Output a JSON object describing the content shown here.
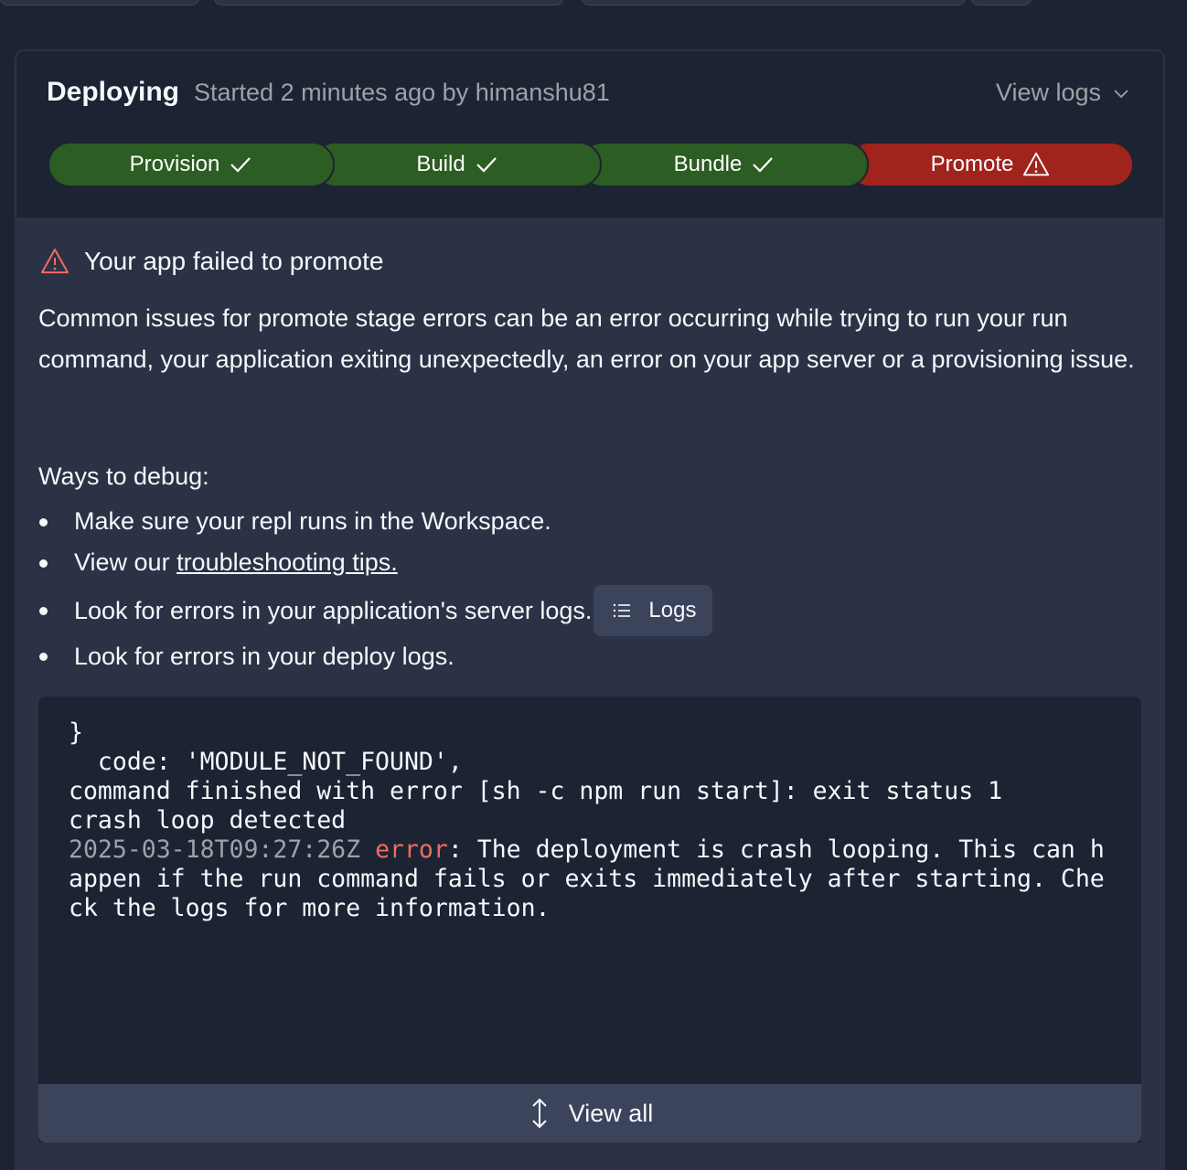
{
  "deployment": {
    "title": "Deploying",
    "subtitle": "Started 2 minutes ago by himanshu81",
    "view_logs_label": "View logs",
    "stages": [
      {
        "label": "Provision",
        "status": "success",
        "icon": "check-icon"
      },
      {
        "label": "Build",
        "status": "success",
        "icon": "check-icon"
      },
      {
        "label": "Bundle",
        "status": "success",
        "icon": "check-icon"
      },
      {
        "label": "Promote",
        "status": "failed",
        "icon": "warning-icon"
      }
    ]
  },
  "failure": {
    "heading": "Your app failed to promote",
    "description": "Common issues for promote stage errors can be an error occurring while trying to run your run command, your application exiting unexpectedly, an error on your app server or a provisioning issue.",
    "debug_title": "Ways to debug:",
    "debug_items": [
      "Make sure your repl runs in the Workspace.",
      "View our ",
      "Look for errors in your application's server logs.",
      "Look for errors in your deploy logs."
    ],
    "troubleshooting_link": "troubleshooting tips.",
    "logs_button_label": "Logs"
  },
  "console": {
    "line1": "}",
    "line2": "  code: 'MODULE_NOT_FOUND',",
    "line3": "command finished with error [sh -c npm run start]: exit status 1",
    "line4": "crash loop detected",
    "timestamp": "2025-03-18T09:27:26Z",
    "error_word": "error",
    "message_part1": ": The deployment is crash looping. This can h",
    "message_part2": "appen if the run command fails or exits immediately after starting. Che",
    "message_part3": "ck the logs for more information."
  },
  "view_all_label": "View all",
  "colors": {
    "success": "#2c5d22",
    "failed": "#a0231c",
    "error_text": "#f36b5f",
    "background": "#1c2333",
    "surface": "#2b3245"
  }
}
